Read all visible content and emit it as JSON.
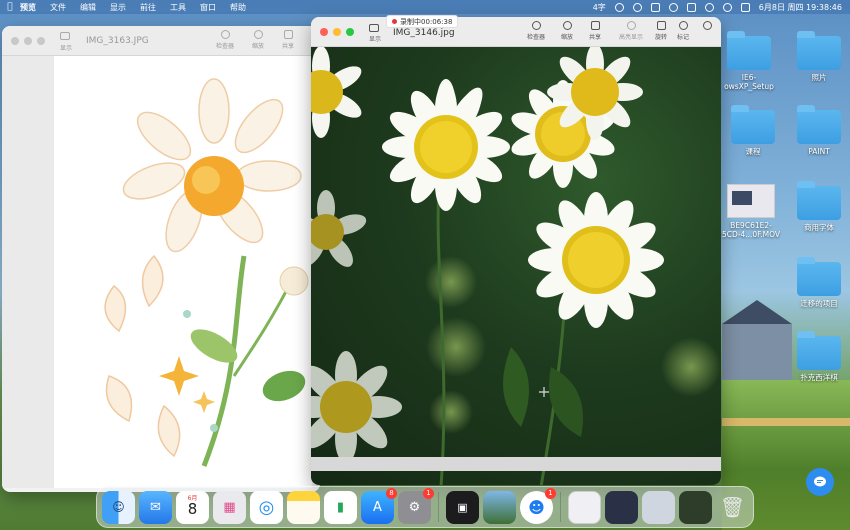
{
  "menubar": {
    "app_name": "预览",
    "items": [
      "文件",
      "编辑",
      "显示",
      "前往",
      "工具",
      "窗口",
      "帮助"
    ],
    "status_text": "4字",
    "datetime": "6月8日 周四  19:38:46"
  },
  "recording": {
    "label": "录制中00:06:38"
  },
  "left_window": {
    "title": "IMG_3163.JPG",
    "subtitle": "显示",
    "tools": [
      "检查器",
      "缩放",
      "共享"
    ]
  },
  "right_window": {
    "title": "IMG_3146.jpg",
    "subtitle": "显示",
    "tools": [
      "检查器",
      "缩放",
      "共享",
      "高亮显示",
      "旋转",
      "标记",
      "搜索"
    ]
  },
  "desktop_icons": [
    {
      "label": "IE6-\nowsXP_Setup",
      "kind": "folder"
    },
    {
      "label": "照片",
      "kind": "folder"
    },
    {
      "label": "课程",
      "kind": "folder"
    },
    {
      "label": "PAINT",
      "kind": "folder"
    },
    {
      "label": "BE9C61E2-\n5CD-4...0F.MOV",
      "kind": "thumb"
    },
    {
      "label": "商用字体",
      "kind": "folder"
    },
    {
      "label": "迁移的项目",
      "kind": "folder"
    },
    {
      "label": "扑克西洋棋",
      "kind": "folder"
    }
  ],
  "dock": {
    "calendar_month": "6月",
    "calendar_day": "8",
    "appstore_badge": "8",
    "settings_badge": "1",
    "app3_badge": "1"
  },
  "colors": {
    "close": "#ff5f57",
    "minimize": "#febc2e",
    "zoom": "#28c840",
    "inactive_light": "#c8c8c8",
    "folder": "#3d9fe2"
  }
}
